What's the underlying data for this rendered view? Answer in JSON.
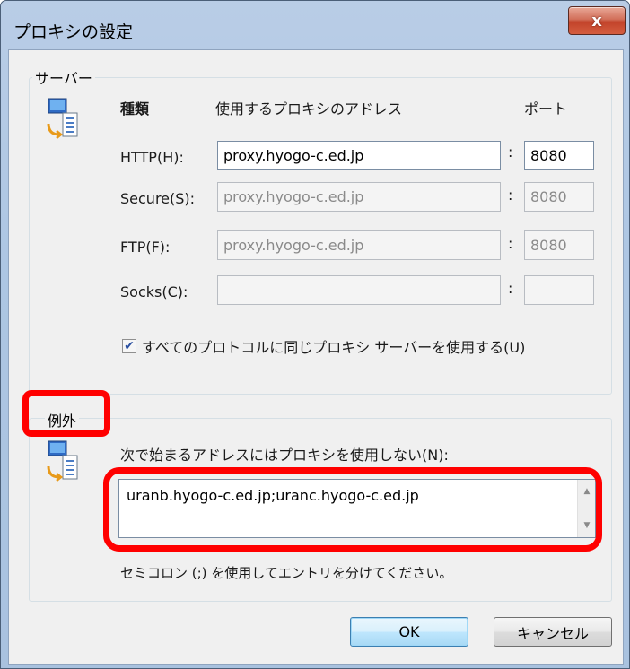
{
  "window": {
    "title": "プロキシの設定",
    "close_label": "x"
  },
  "server_group": {
    "label": "サーバー",
    "col_type": "種類",
    "col_address": "使用するプロキシのアドレス",
    "col_port": "ポート",
    "rows": [
      {
        "label": "HTTP(H):",
        "address": "proxy.hyogo-c.ed.jp",
        "port": "8080",
        "enabled": true
      },
      {
        "label": "Secure(S):",
        "address": "proxy.hyogo-c.ed.jp",
        "port": "8080",
        "enabled": false
      },
      {
        "label": "FTP(F):",
        "address": "proxy.hyogo-c.ed.jp",
        "port": "8080",
        "enabled": false
      },
      {
        "label": "Socks(C):",
        "address": "",
        "port": "",
        "enabled": false
      }
    ],
    "colon": ":",
    "same_proxy_checkbox": {
      "label": "すべてのプロトコルに同じプロキシ サーバーを使用する(U)",
      "checked": true
    }
  },
  "exceptions_group": {
    "label": "例外",
    "description": "次で始まるアドレスにはプロキシを使用しない(N):",
    "value": "uranb.hyogo-c.ed.jp;uranc.hyogo-c.ed.jp",
    "hint": "セミコロン (;) を使用してエントリを分けてください。"
  },
  "buttons": {
    "ok": "OK",
    "cancel": "キャンセル"
  },
  "icons": {
    "server": "computer-network-icon",
    "exceptions": "computer-network-icon",
    "close": "close-icon",
    "checkmark": "checkmark-icon",
    "scroll_up": "scroll-up-arrow-icon",
    "scroll_down": "scroll-down-arrow-icon"
  },
  "colors": {
    "highlight": "#ff0000",
    "window_frame": "#adc6e3",
    "close_button": "#c2432a"
  }
}
